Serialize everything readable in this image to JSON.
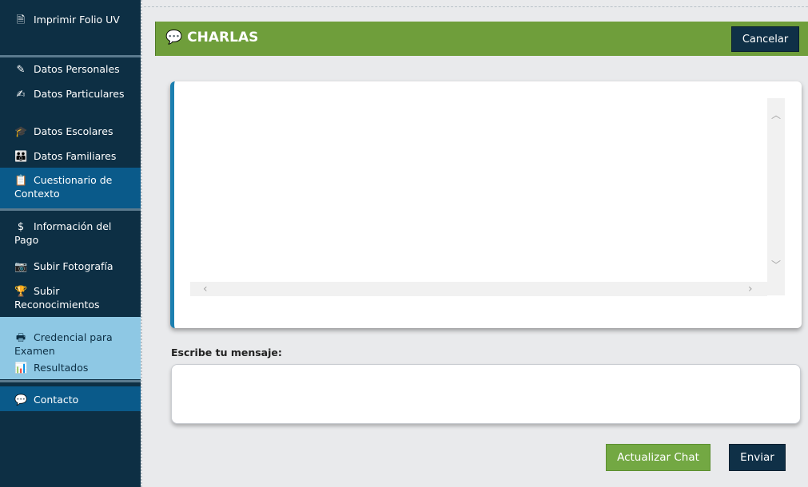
{
  "sidebar": {
    "items": [
      {
        "label": "Imprimir Folio UV",
        "icon": "document-icon",
        "glyph": "🗎"
      },
      {
        "label": "Datos Personales",
        "icon": "pencil-icon",
        "glyph": "✎"
      },
      {
        "label": "Datos Particulares",
        "icon": "edit-icon",
        "glyph": "✍"
      },
      {
        "label": "Datos Escolares",
        "icon": "graduation-cap-icon",
        "glyph": "🎓"
      },
      {
        "label": "Datos Familiares",
        "icon": "users-icon",
        "glyph": "👪"
      },
      {
        "label": "Cuestionario de Contexto",
        "icon": "clipboard-icon",
        "glyph": "📋"
      },
      {
        "label": "Información del Pago",
        "icon": "dollar-icon",
        "glyph": "$"
      },
      {
        "label": "Subir Fotografía",
        "icon": "camera-icon",
        "glyph": "📷"
      },
      {
        "label": "Subir Reconocimientos",
        "icon": "trophy-icon",
        "glyph": "🏆"
      },
      {
        "label": "Credencial para Examen",
        "icon": "print-icon",
        "glyph": "🖶"
      },
      {
        "label": "Resultados",
        "icon": "bar-chart-icon",
        "glyph": "📊"
      },
      {
        "label": "Contacto",
        "icon": "chat-bubble-icon",
        "glyph": "💬"
      }
    ],
    "colors": {
      "dark": "#0d2f44",
      "active": "#0a5a8a",
      "light": "#8ec8e4"
    }
  },
  "header": {
    "title": "CHARLAS",
    "icon": "chat-bubble-icon",
    "cancel_label": "Cancelar",
    "color": "#6f9e3b"
  },
  "chat": {
    "accent": "#1c7fb0"
  },
  "message": {
    "label": "Escribe tu mensaje:",
    "value": ""
  },
  "buttons": {
    "refresh_label": "Actualizar Chat",
    "send_label": "Enviar"
  }
}
